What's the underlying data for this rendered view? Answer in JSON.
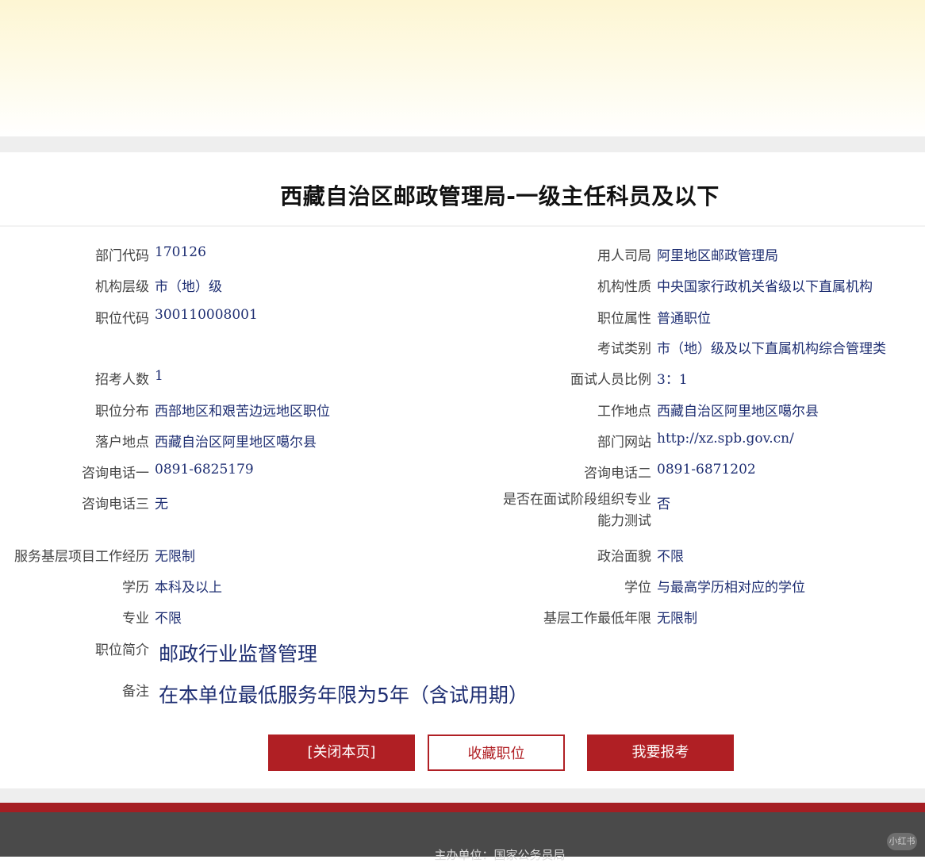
{
  "page": {
    "title": "西藏自治区邮政管理局-一级主任科员及以下"
  },
  "details": {
    "dept_code_label": "部门代码",
    "dept_code": "170126",
    "employer_label": "用人司局",
    "employer": "阿里地区邮政管理局",
    "org_level_label": "机构层级",
    "org_level": "市（地）级",
    "org_nature_label": "机构性质",
    "org_nature": "中央国家行政机关省级以下直属机构",
    "position_code_label": "职位代码",
    "position_code": "300110008001",
    "position_attr_label": "职位属性",
    "position_attr": "普通职位",
    "exam_category_label": "考试类别",
    "exam_category": "市（地）级及以下直属机构综合管理类",
    "recruit_count_label": "招考人数",
    "recruit_count": "1",
    "interview_ratio_label": "面试人员比例",
    "interview_ratio": "3：1",
    "distribution_label": "职位分布",
    "distribution": "西部地区和艰苦边远地区职位",
    "work_location_label": "工作地点",
    "work_location": "西藏自治区阿里地区噶尔县",
    "hukou_label": "落户地点",
    "hukou": "西藏自治区阿里地区噶尔县",
    "website_label": "部门网站",
    "website": "http://xz.spb.gov.cn/",
    "phone1_label": "咨询电话一",
    "phone1": "0891-6825179",
    "phone2_label": "咨询电话二",
    "phone2": "0891-6871202",
    "phone3_label": "咨询电话三",
    "phone3": "无",
    "special_test_label": "是否在面试阶段组织专业能力测试",
    "special_test": "否",
    "grassroots_project_label": "服务基层项目工作经历",
    "grassroots_project": "无限制",
    "political_label": "政治面貌",
    "political": "不限",
    "education_label": "学历",
    "education": "本科及以上",
    "degree_label": "学位",
    "degree": "与最高学历相对应的学位",
    "major_label": "专业",
    "major": "不限",
    "min_years_label": "基层工作最低年限",
    "min_years": "无限制",
    "intro_label": "职位简介",
    "intro": "邮政行业监督管理",
    "remark_label": "备注",
    "remark": "在本单位最低服务年限为5年（含试用期）"
  },
  "buttons": {
    "close": "[关闭本页]",
    "favorite": "收藏职位",
    "apply": "我要报考"
  },
  "footer": {
    "text": "主办单位：国家公务员局",
    "watermark": "小红书"
  },
  "colors": {
    "accent_red": "#b01f24",
    "value_blue": "#1e2e72"
  }
}
